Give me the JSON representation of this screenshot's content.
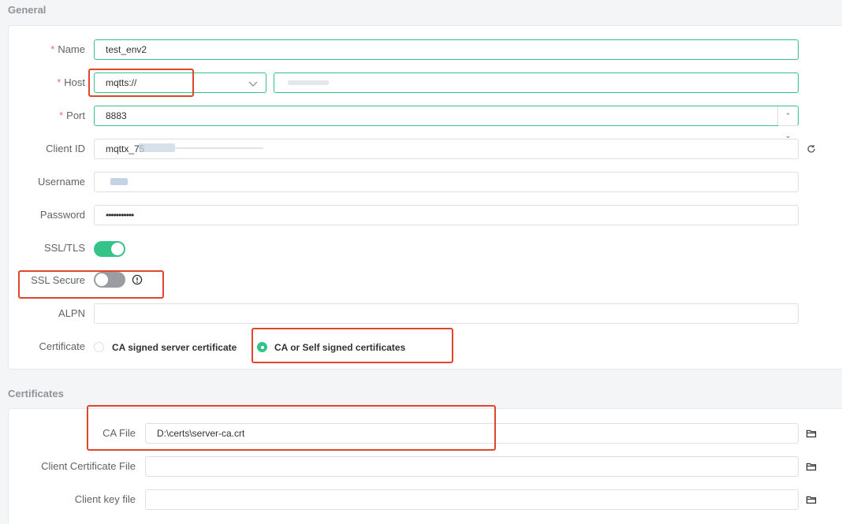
{
  "general": {
    "section_title": "General",
    "name": {
      "label": "Name",
      "value": "test_env2"
    },
    "host": {
      "label": "Host",
      "protocol": "mqtts://",
      "value": ""
    },
    "port": {
      "label": "Port",
      "value": "8883"
    },
    "client_id": {
      "label": "Client ID",
      "value": "mqttx_75"
    },
    "username": {
      "label": "Username",
      "value": ""
    },
    "password": {
      "label": "Password",
      "value": "•••••••••••"
    },
    "ssl_tls": {
      "label": "SSL/TLS",
      "enabled": true
    },
    "ssl_secure": {
      "label": "SSL Secure",
      "enabled": false
    },
    "alpn": {
      "label": "ALPN",
      "value": ""
    },
    "certificate": {
      "label": "Certificate",
      "options": [
        "CA signed server certificate",
        "CA or Self signed certificates"
      ],
      "selected": "CA or Self signed certificates"
    }
  },
  "certificates": {
    "section_title": "Certificates",
    "ca_file": {
      "label": "CA File",
      "value": "D:\\certs\\server-ca.crt"
    },
    "client_cert": {
      "label": "Client Certificate File",
      "value": ""
    },
    "client_key": {
      "label": "Client key file",
      "value": ""
    }
  },
  "icons": {
    "refresh": "refresh-icon",
    "folder": "folder-icon",
    "info": "info-icon",
    "chevron": "chevron-down-icon"
  },
  "colors": {
    "accent": "#34c388",
    "required": "#f56c6c",
    "highlight": "#e0452e"
  }
}
